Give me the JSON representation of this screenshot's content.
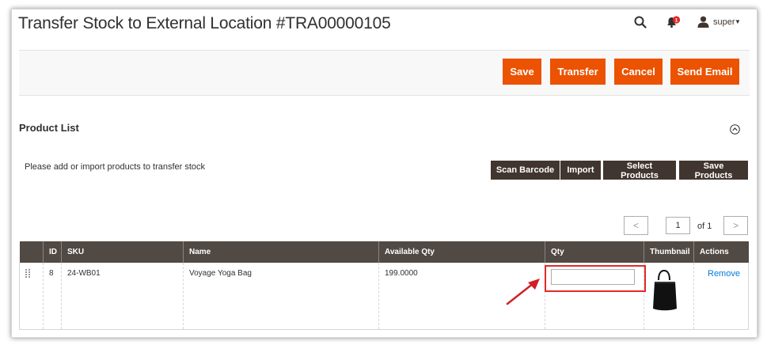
{
  "header": {
    "title": "Transfer Stock to External Location #TRA00000105",
    "notification_count": "1",
    "user_name": "super"
  },
  "actions": {
    "save": "Save",
    "transfer": "Transfer",
    "cancel": "Cancel",
    "send_email": "Send Email"
  },
  "product_list": {
    "title": "Product List",
    "hint": "Please add or import products to transfer stock",
    "buttons": {
      "scan_barcode": "Scan Barcode",
      "import": "Import",
      "select_products": "Select Products",
      "save_products": "Save Products"
    },
    "pager": {
      "prev": "<",
      "next": ">",
      "current_page": "1",
      "of_label": "of 1"
    },
    "columns": [
      "ID",
      "SKU",
      "Name",
      "Available Qty",
      "Qty",
      "Thumbnail",
      "Actions"
    ],
    "rows": [
      {
        "id": "8",
        "sku": "24-WB01",
        "name": "Voyage Yoga Bag",
        "available_qty": "199.0000",
        "qty": "",
        "remove": "Remove"
      }
    ]
  },
  "colors": {
    "primary_button": "#eb5202",
    "secondary_button": "#41362f",
    "grid_header": "#514943",
    "highlight": "#e02b27",
    "link": "#007bdb"
  }
}
